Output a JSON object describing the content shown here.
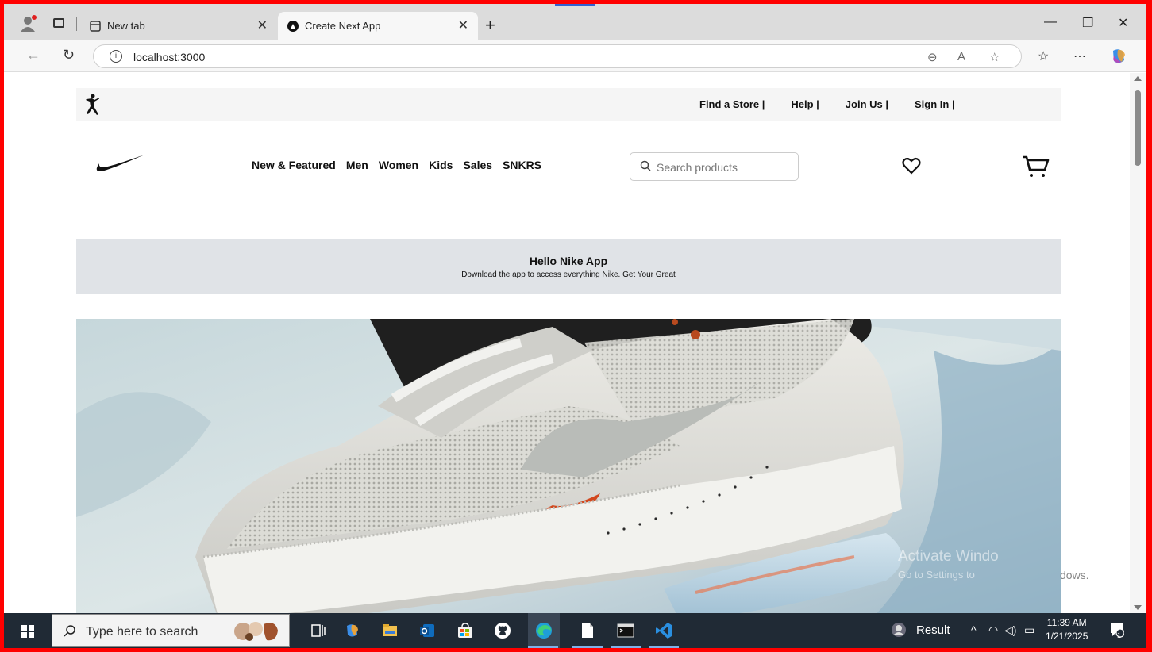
{
  "browser": {
    "tabs": [
      {
        "title": "New tab",
        "close": "✕"
      },
      {
        "title": "Create Next App",
        "close": "✕"
      }
    ],
    "new_tab": "+",
    "window_controls": {
      "minimize": "—",
      "restore": "❐",
      "close": "✕"
    },
    "url": "localhost:3000"
  },
  "site": {
    "utility_links": [
      "Find a Store |",
      "Help |",
      "Join Us |",
      "Sign In |"
    ],
    "nav": [
      "New & Featured",
      "Men",
      "Women",
      "Kids",
      "Sales",
      "SNKRS"
    ],
    "search_placeholder": "Search products",
    "banner": {
      "title": "Hello Nike App",
      "subtitle": "Download the app to access everything Nike. Get Your Great"
    }
  },
  "watermark": {
    "line1": "Activate Windo",
    "line2": "Go to Settings to",
    "line2_tail": "dows."
  },
  "taskbar": {
    "search_placeholder": "Type here to search",
    "result_label": "Result",
    "time": "11:39 AM",
    "date": "1/21/2025",
    "notification_count": "1"
  },
  "colors": {
    "frame_border": "#ff0000",
    "taskbar": "#202a35",
    "banner_bg": "#e0e3e7"
  }
}
